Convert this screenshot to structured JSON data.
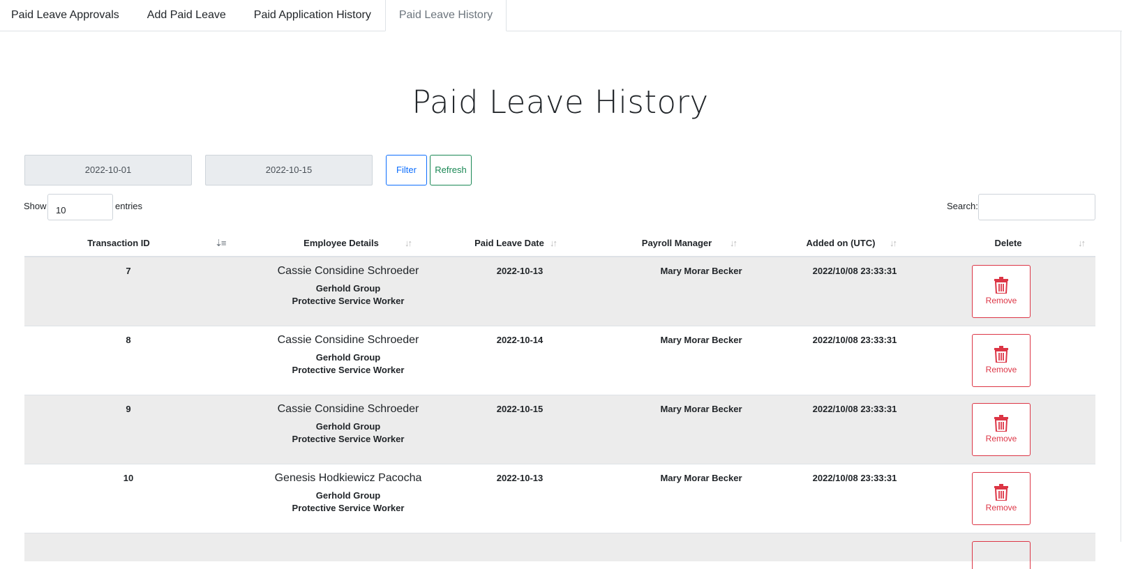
{
  "tabs": [
    {
      "label": "Paid Leave Approvals"
    },
    {
      "label": "Add Paid Leave"
    },
    {
      "label": "Paid Application History"
    },
    {
      "label": "Paid Leave History"
    }
  ],
  "active_tab": "Paid Leave History",
  "page_title": "Paid Leave History",
  "filter": {
    "start_date": "2022-10-01",
    "end_date": "2022-10-15",
    "filter_label": "Filter",
    "refresh_label": "Refresh"
  },
  "length": {
    "show_label": "Show",
    "value": "10",
    "entries_label": "entries"
  },
  "search": {
    "label": "Search:",
    "value": ""
  },
  "columns": [
    "Transaction ID",
    "Employee Details",
    "Paid Leave Date",
    "Payroll Manager",
    "Added on (UTC)",
    "Delete"
  ],
  "sort_icons": {
    "sorted": "⇣≡",
    "unsorted": "↓↑"
  },
  "rows": [
    {
      "id": "7",
      "name": "Cassie Considine Schroeder",
      "company": "Gerhold Group",
      "title": "Protective Service Worker",
      "date": "2022-10-13",
      "manager": "Mary Morar Becker",
      "added": "2022/10/08 23:33:31",
      "action": "Remove"
    },
    {
      "id": "8",
      "name": "Cassie Considine Schroeder",
      "company": "Gerhold Group",
      "title": "Protective Service Worker",
      "date": "2022-10-14",
      "manager": "Mary Morar Becker",
      "added": "2022/10/08 23:33:31",
      "action": "Remove"
    },
    {
      "id": "9",
      "name": "Cassie Considine Schroeder",
      "company": "Gerhold Group",
      "title": "Protective Service Worker",
      "date": "2022-10-15",
      "manager": "Mary Morar Becker",
      "added": "2022/10/08 23:33:31",
      "action": "Remove"
    },
    {
      "id": "10",
      "name": "Genesis Hodkiewicz Pacocha",
      "company": "Gerhold Group",
      "title": "Protective Service Worker",
      "date": "2022-10-13",
      "manager": "Mary Morar Becker",
      "added": "2022/10/08 23:33:31",
      "action": "Remove"
    }
  ],
  "colors": {
    "primary": "#0d6efd",
    "success": "#198754",
    "danger": "#dc3545",
    "stripe": "#ececec"
  },
  "icons": {
    "sort": "sort-icon",
    "remove": "trash-icon"
  }
}
